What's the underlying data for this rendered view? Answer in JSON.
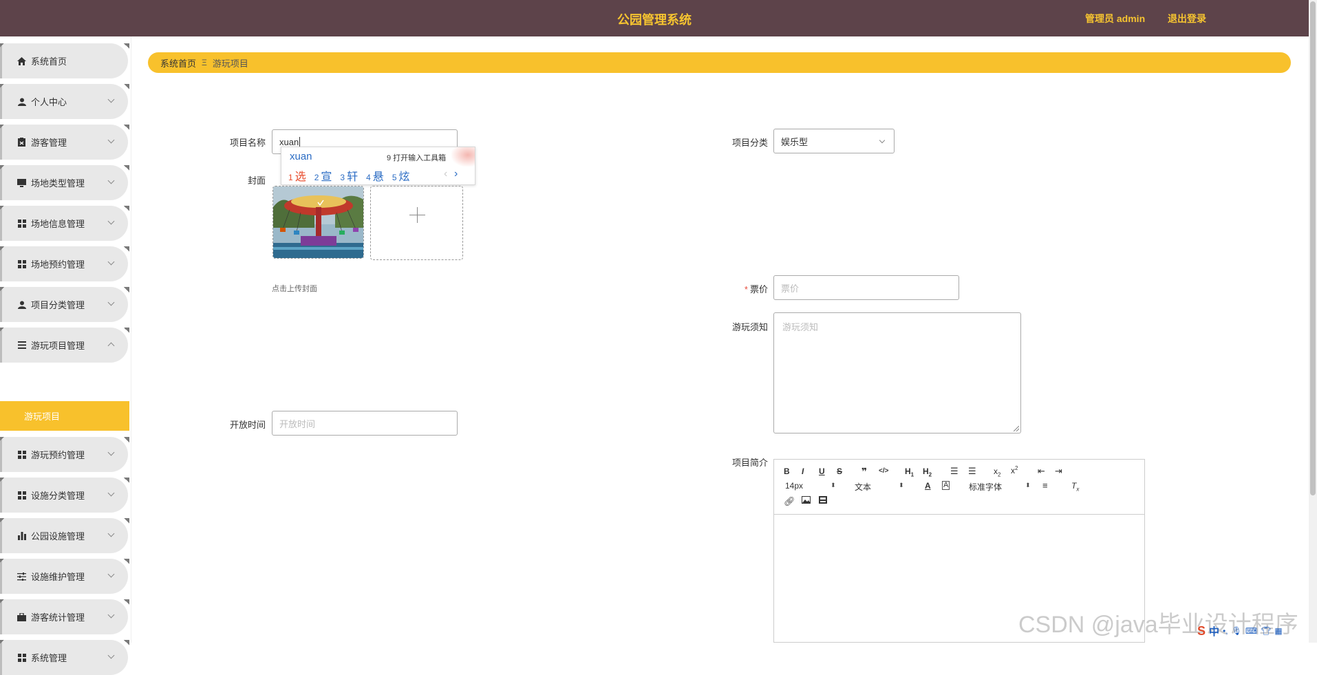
{
  "header": {
    "title": "公园管理系统",
    "user": "管理员 admin",
    "logout": "退出登录"
  },
  "sidebar": {
    "items": [
      {
        "label": "系统首页",
        "icon": "home-icon"
      },
      {
        "label": "个人中心",
        "icon": "user-icon"
      },
      {
        "label": "游客管理",
        "icon": "id-card-icon"
      },
      {
        "label": "场地类型管理",
        "icon": "monitor-icon"
      },
      {
        "label": "场地信息管理",
        "icon": "grid-icon"
      },
      {
        "label": "场地预约管理",
        "icon": "grid-icon"
      },
      {
        "label": "项目分类管理",
        "icon": "user-icon"
      },
      {
        "label": "游玩项目管理",
        "icon": "list-icon"
      },
      {
        "label": "游玩预约管理",
        "icon": "grid-icon"
      },
      {
        "label": "设施分类管理",
        "icon": "grid-icon"
      },
      {
        "label": "公园设施管理",
        "icon": "bar-chart-icon"
      },
      {
        "label": "设施维护管理",
        "icon": "sliders-icon"
      },
      {
        "label": "游客统计管理",
        "icon": "briefcase-icon"
      },
      {
        "label": "系统管理",
        "icon": "grid-icon"
      }
    ],
    "active_sub": "游玩项目"
  },
  "breadcrumb": {
    "home": "系统首页",
    "separator": "Ξ",
    "current": "游玩项目"
  },
  "form": {
    "name_label": "项目名称",
    "name_value": "xuan",
    "cover_label": "封面",
    "cover_tip": "点击上传封面",
    "open_time_label": "开放时间",
    "open_time_placeholder": "开放时间",
    "category_label": "项目分类",
    "category_value": "娱乐型",
    "price_label": "票价",
    "price_placeholder": "票价",
    "notice_label": "游玩须知",
    "notice_placeholder": "游玩须知",
    "intro_label": "项目简介"
  },
  "ime": {
    "pinyin": "xuan",
    "toolbox": "9 打开输入工具箱",
    "candidates": [
      {
        "num": "1",
        "text": "选"
      },
      {
        "num": "2",
        "text": "宣"
      },
      {
        "num": "3",
        "text": "轩"
      },
      {
        "num": "4",
        "text": "悬"
      },
      {
        "num": "5",
        "text": "炫"
      }
    ],
    "prev": "‹",
    "next": "›"
  },
  "editor": {
    "font_size": "14px",
    "header_type": "文本",
    "font_family": "标准字体"
  },
  "watermark": "CSDN @java毕业设计程序",
  "tray": {
    "ime_mode": "中"
  },
  "colors": {
    "header_bg": "#5d434a",
    "accent": "#f8c12c",
    "title_color": "#f6c430"
  }
}
